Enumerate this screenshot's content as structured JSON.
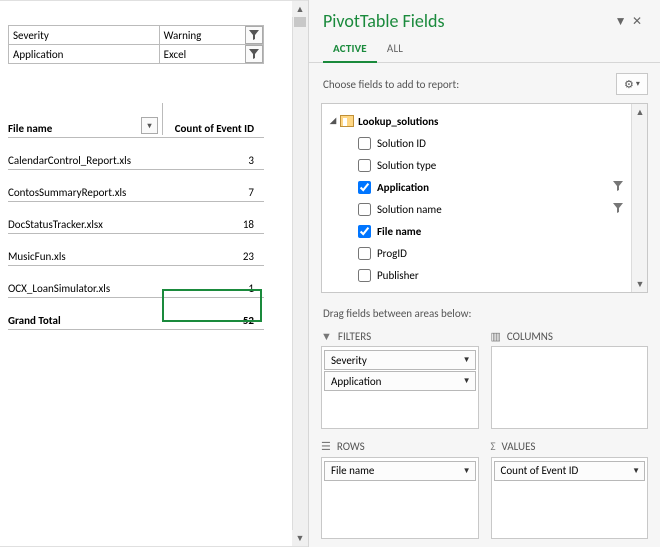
{
  "slicers": [
    {
      "label": "Severity",
      "value": "Warning"
    },
    {
      "label": "Application",
      "value": "Excel"
    }
  ],
  "pivot": {
    "row_header": "File name",
    "value_header": "Count of Event ID",
    "rows": [
      {
        "file": "CalendarControl_Report.xls",
        "count": 3
      },
      {
        "file": "ContosSummaryReport.xls",
        "count": 7
      },
      {
        "file": "DocStatusTracker.xlsx",
        "count": 18
      },
      {
        "file": "MusicFun.xls",
        "count": 23
      },
      {
        "file": "OCX_LoanSimulator.xls",
        "count": 1
      }
    ],
    "grand_total_label": "Grand Total",
    "grand_total_value": 52
  },
  "pane": {
    "title": "PivotTable Fields",
    "tabs": {
      "active": "ACTIVE",
      "all": "ALL"
    },
    "choose_label": "Choose fields to add to report:",
    "group": "Lookup_solutions",
    "fields": [
      {
        "name": "Solution ID",
        "checked": false,
        "bold": false,
        "filter": false
      },
      {
        "name": "Solution type",
        "checked": false,
        "bold": false,
        "filter": false
      },
      {
        "name": "Application",
        "checked": true,
        "bold": true,
        "filter": true
      },
      {
        "name": "Solution name",
        "checked": false,
        "bold": false,
        "filter": true,
        "overflow": true
      },
      {
        "name": "File name",
        "checked": true,
        "bold": true,
        "filter": false
      },
      {
        "name": "ProgID",
        "checked": false,
        "bold": false,
        "filter": false
      },
      {
        "name": "Publisher",
        "checked": false,
        "bold": false,
        "filter": false
      }
    ],
    "drag_label": "Drag fields between areas below:",
    "areas": {
      "filters": {
        "title": "FILTERS",
        "items": [
          "Severity",
          "Application"
        ]
      },
      "columns": {
        "title": "COLUMNS",
        "items": []
      },
      "rows": {
        "title": "ROWS",
        "items": [
          "File name"
        ]
      },
      "values": {
        "title": "VALUES",
        "items": [
          "Count of Event ID"
        ]
      }
    }
  }
}
